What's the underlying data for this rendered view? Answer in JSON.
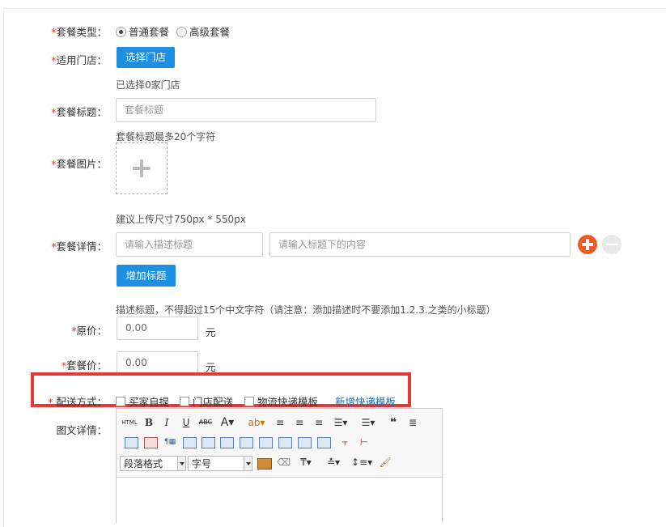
{
  "form": {
    "package_type": {
      "label": "套餐类型：",
      "options": [
        "普通套餐",
        "高级套餐"
      ],
      "selected": "普通套餐"
    },
    "store": {
      "label": "适用门店：",
      "button": "选择门店",
      "hint": "已选择0家门店"
    },
    "title": {
      "label": "套餐标题：",
      "placeholder": "套餐标题",
      "hint": "套餐标题最多20个字符"
    },
    "image": {
      "label": "套餐图片：",
      "hint": "建议上传尺寸750px * 550px"
    },
    "details": {
      "label": "套餐详情：",
      "title_placeholder": "请输入描述标题",
      "content_placeholder": "请输入标题下的内容",
      "add_button": "增加标题",
      "hint": "描述标题，不得超过15个中文字符（请注意：添加描述时不要添加1.2.3.之类的小标题）"
    },
    "original_price": {
      "label": "原价：",
      "value": "0.00",
      "unit": "元"
    },
    "package_price": {
      "label": "套餐价：",
      "value": "0.00",
      "unit": "元"
    },
    "delivery": {
      "label": "配送方式：",
      "options": [
        "买家自提",
        "门店配送",
        "物流快递模板"
      ],
      "link": "新增快递模板"
    },
    "content": {
      "label": "图文详情："
    }
  },
  "editor": {
    "html_label": "HTML",
    "paragraph_select": "段落格式",
    "fontsize_select": "字号"
  },
  "colors": {
    "accent": "#1e8fe1",
    "required": "#e4393c",
    "highlight_box": "#e53935",
    "add_icon": "#f15a22"
  }
}
